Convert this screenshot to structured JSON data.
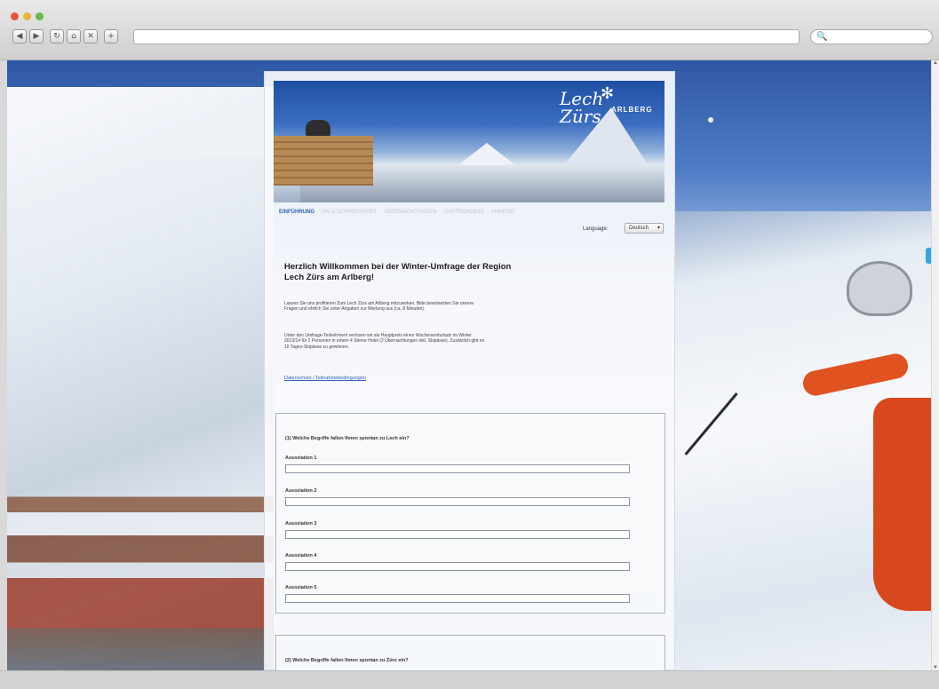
{
  "browser": {
    "window_colors": {
      "close": "#e5533d",
      "minimize": "#e9b73a",
      "zoom": "#69b94a"
    },
    "toolbar_buttons": [
      {
        "icon": "back-arrow-icon",
        "glyph": "◀"
      },
      {
        "icon": "forward-arrow-icon",
        "glyph": "▶"
      },
      {
        "icon": "reload-icon",
        "glyph": "↻"
      },
      {
        "icon": "home-icon",
        "glyph": "⌂"
      },
      {
        "icon": "stop-icon",
        "glyph": "✕"
      },
      {
        "icon": "add-tab-icon",
        "glyph": "+"
      }
    ],
    "address_value": "",
    "search_glyph": "🔍"
  },
  "banner": {
    "logo_line1": "Lech",
    "logo_line2": "Zürs",
    "logo_sub": "ARLBERG"
  },
  "tabs": [
    "EINFÜHRUNG",
    "SKI & SCHNEESPORT",
    "ÜBERNACHTUNGEN",
    "GASTRONOMIE",
    "ANREISE"
  ],
  "language": {
    "label": "Language:",
    "selected": "Deutsch"
  },
  "welcome": {
    "title": "Herzlich Willkommen bei der Winter-Umfrage der Region Lech Zürs am Arlberg!",
    "intro": "Lassen Sie uns profitieren Zum Lech Zürs am Arlberg mitzuwirken. Bitte beantworten Sie unsere Fragen und ehrlich Sie unter Angaben zur Wertung aus (ca. 8 Minuten).",
    "prize": "Unter den Umfrage-Teilnehmern verlosen wir als Hauptpreis einen Wochenendurlaub im Winter 2013/14 für 2 Personen in einem 4 Sterne Hotel (2 Übernachtungen inkl. Skipässe). Zusätzlich gibt es 10 Tages-Skipässe zu gewinnen.",
    "privacy_link": "Datenschutz / Teilnahmebedingungen"
  },
  "question1": {
    "title": "(1) Welche Begriffe fallen Ihnen spontan zu Lech ein?",
    "fields": [
      {
        "label": "Assoziation 1",
        "value": ""
      },
      {
        "label": "Assoziation 2",
        "value": ""
      },
      {
        "label": "Assoziation 3",
        "value": ""
      },
      {
        "label": "Assoziation 4",
        "value": ""
      },
      {
        "label": "Assoziation 5",
        "value": ""
      }
    ]
  },
  "question2": {
    "title": "(2) Welche Begriffe fallen Ihnen spontan zu Zürs ein?"
  }
}
